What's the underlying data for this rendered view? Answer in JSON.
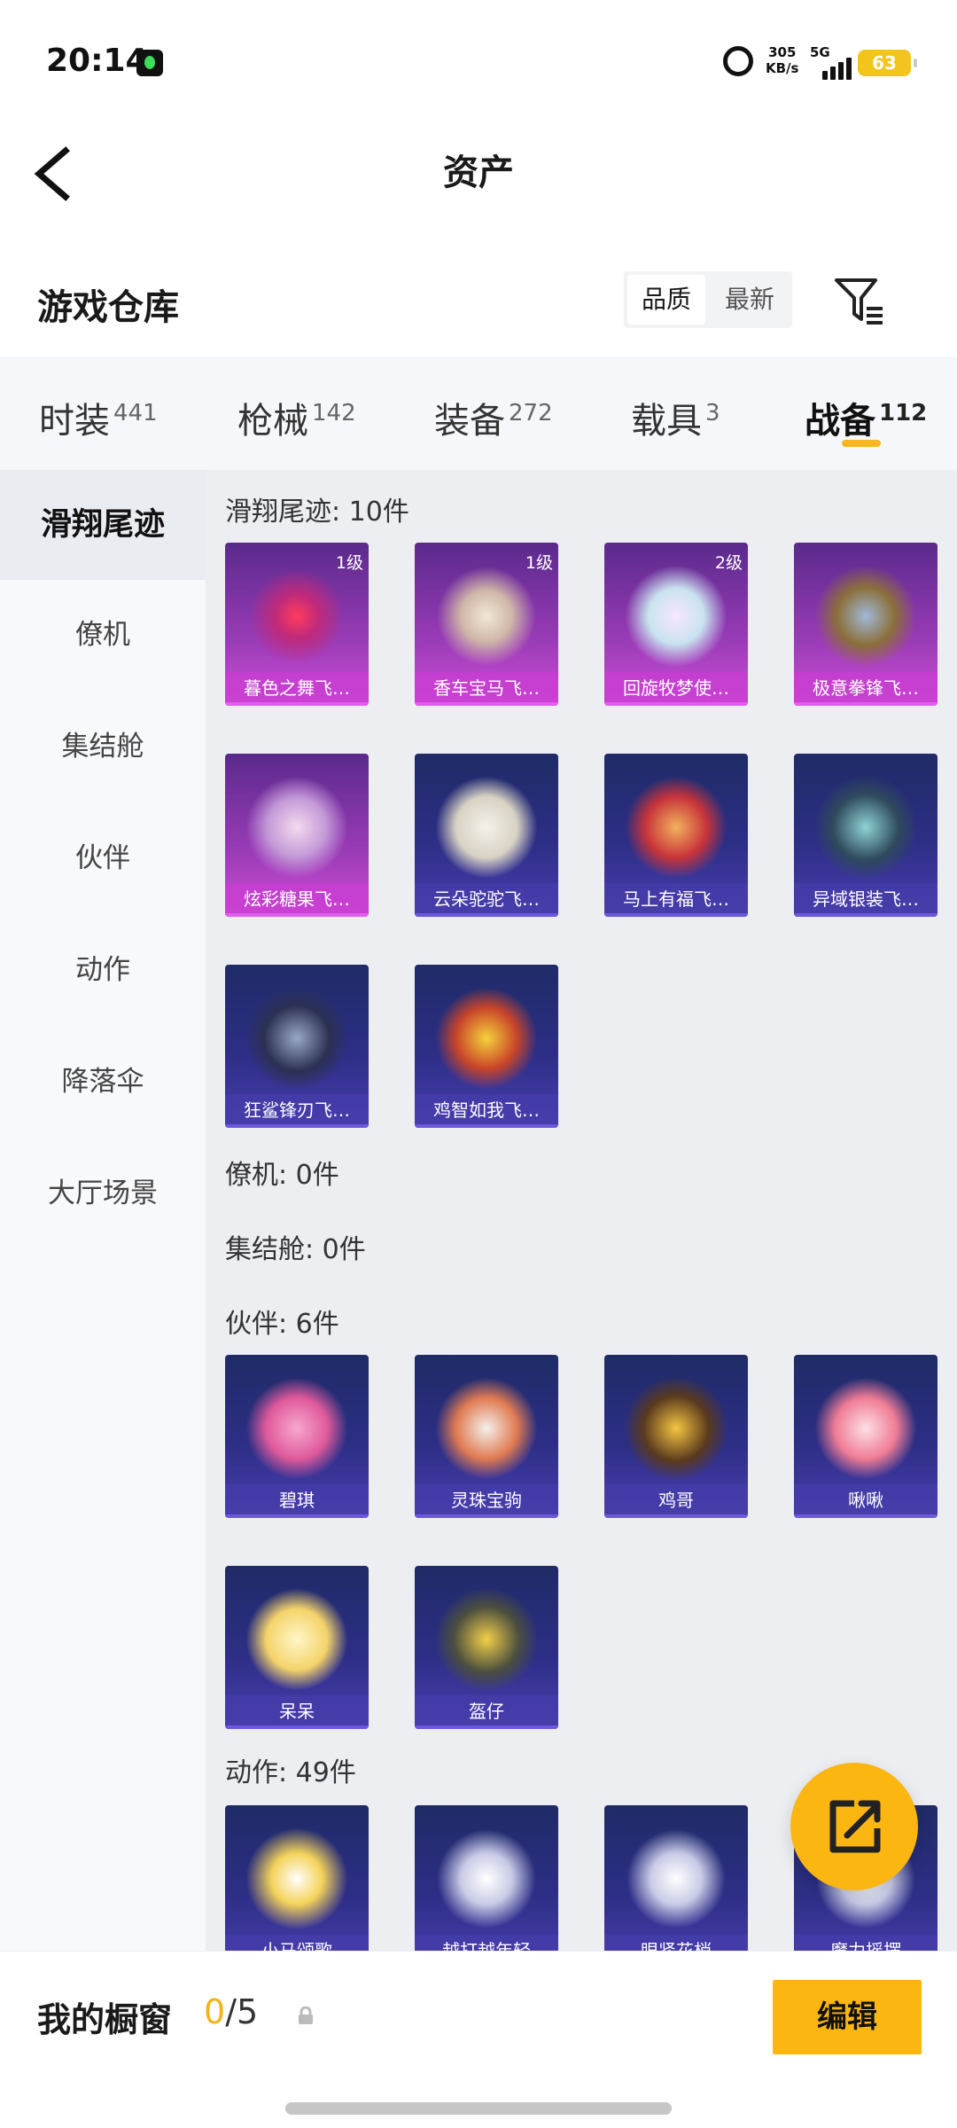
{
  "status_bar": {
    "time": "20:14",
    "net_speed_value": "305",
    "net_speed_unit": "KB/s",
    "network": "5G",
    "battery": "63"
  },
  "nav": {
    "title": "资产"
  },
  "section": {
    "title": "游戏仓库",
    "sort_options": [
      "品质",
      "最新"
    ]
  },
  "category_tabs": [
    {
      "label": "时装",
      "count": "441"
    },
    {
      "label": "枪械",
      "count": "142"
    },
    {
      "label": "装备",
      "count": "272"
    },
    {
      "label": "载具",
      "count": "3"
    },
    {
      "label": "战备",
      "count": "112"
    }
  ],
  "side_nav": [
    "滑翔尾迹",
    "僚机",
    "集结舱",
    "伙伴",
    "动作",
    "降落伞",
    "大厅场景"
  ],
  "groups": {
    "glide": {
      "label": "滑翔尾迹: 10件",
      "items": [
        {
          "name": "暮色之舞飞…",
          "level": "1级"
        },
        {
          "name": "香车宝马飞…",
          "level": "1级"
        },
        {
          "name": "回旋牧梦使…",
          "level": "2级"
        },
        {
          "name": "极意拳锋飞…",
          "level": ""
        },
        {
          "name": "炫彩糖果飞…",
          "level": ""
        },
        {
          "name": "云朵驼驼飞…",
          "level": ""
        },
        {
          "name": "马上有福飞…",
          "level": ""
        },
        {
          "name": "异域银装飞…",
          "level": ""
        },
        {
          "name": "狂鲨锋刃飞…",
          "level": ""
        },
        {
          "name": "鸡智如我飞…",
          "level": ""
        }
      ]
    },
    "wingman": {
      "label": "僚机: 0件"
    },
    "capsule": {
      "label": "集结舱: 0件"
    },
    "partner": {
      "label": "伙伴: 6件",
      "items": [
        {
          "name": "碧琪"
        },
        {
          "name": "灵珠宝驹"
        },
        {
          "name": "鸡哥"
        },
        {
          "name": "啾啾"
        },
        {
          "name": "呆呆"
        },
        {
          "name": "盔仔"
        }
      ]
    },
    "emote": {
      "label": "动作: 49件",
      "items": [
        {
          "name": "小马颂歌"
        },
        {
          "name": "越打越年轻"
        },
        {
          "name": "眼紧花梢"
        },
        {
          "name": "魔力摇摆"
        }
      ]
    }
  },
  "bottom": {
    "window_label": "我的橱窗",
    "window_current": "0",
    "window_total": "/5",
    "edit_label": "编辑"
  },
  "colors": {
    "accent": "#fbb612",
    "card_pink": "#9a3bb7",
    "card_blue": "#2d2e86"
  }
}
